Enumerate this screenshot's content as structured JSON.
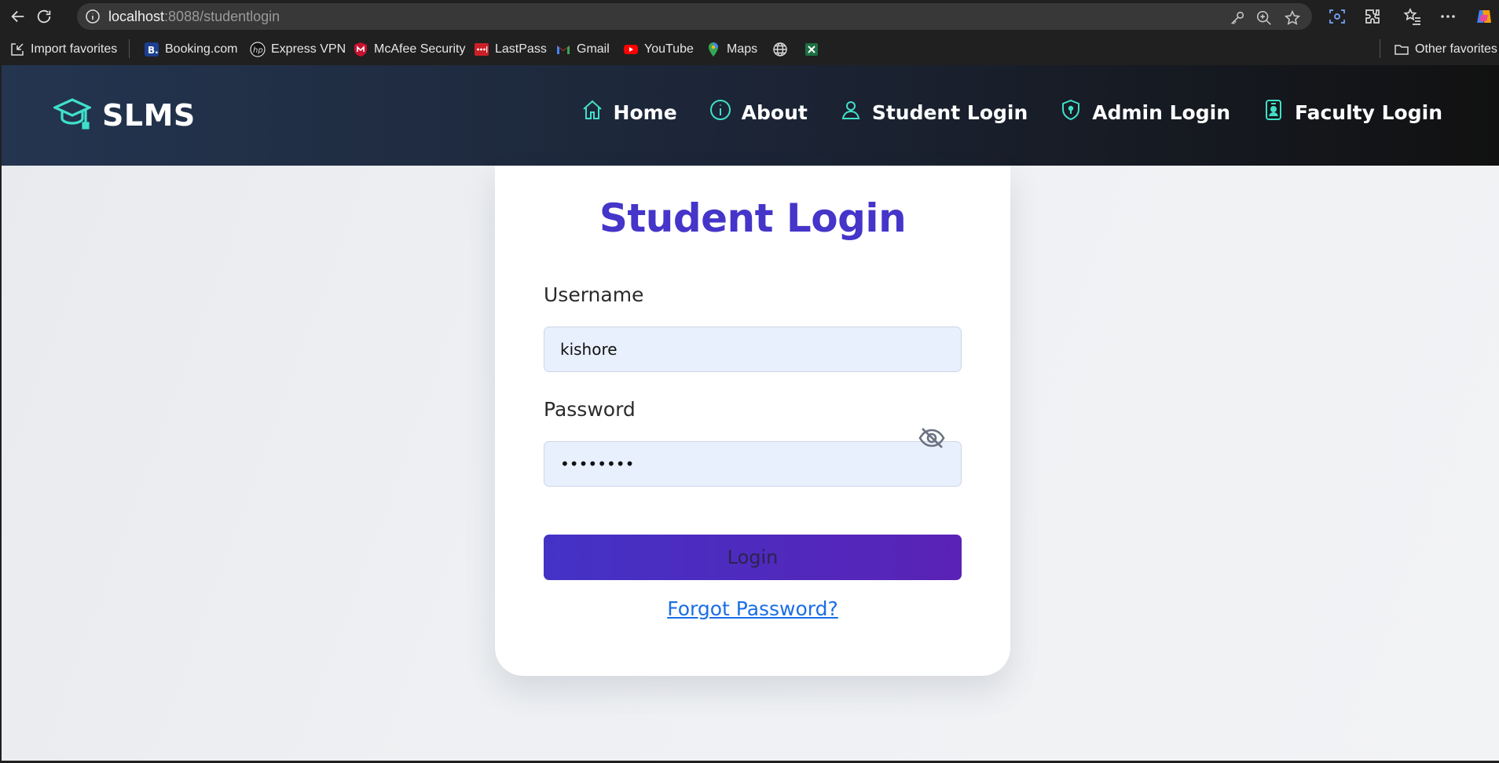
{
  "browser": {
    "url_host": "localhost",
    "url_path": ":8088/studentlogin",
    "favorites": [
      {
        "label": "Import favorites",
        "icon": "import-icon"
      },
      {
        "label": "Booking.com",
        "icon": "booking-icon"
      },
      {
        "label": "Express VPN",
        "icon": "hp-icon"
      },
      {
        "label": "McAfee Security",
        "icon": "mcafee-icon"
      },
      {
        "label": "LastPass",
        "icon": "lastpass-icon"
      },
      {
        "label": "Gmail",
        "icon": "gmail-icon"
      },
      {
        "label": "YouTube",
        "icon": "youtube-icon"
      },
      {
        "label": "Maps",
        "icon": "maps-icon"
      },
      {
        "label": "",
        "icon": "globe-icon"
      },
      {
        "label": "",
        "icon": "excel-icon"
      }
    ],
    "other_favorites": "Other favorites"
  },
  "app": {
    "brand": "SLMS",
    "nav": [
      {
        "label": "Home",
        "icon": "home-icon"
      },
      {
        "label": "About",
        "icon": "info-icon"
      },
      {
        "label": "Student Login",
        "icon": "user-icon"
      },
      {
        "label": "Admin Login",
        "icon": "shield-icon"
      },
      {
        "label": "Faculty Login",
        "icon": "id-badge-icon"
      }
    ]
  },
  "login": {
    "title": "Student Login",
    "username_label": "Username",
    "username_value": "kishore",
    "password_label": "Password",
    "password_value": "kishore1",
    "button": "Login",
    "forgot": "Forgot Password?"
  },
  "colors": {
    "accent": "#40e0c8",
    "title": "#4535c9",
    "link": "#1a6ee6",
    "button_start": "#4432c6",
    "button_end": "#5a22b6"
  }
}
